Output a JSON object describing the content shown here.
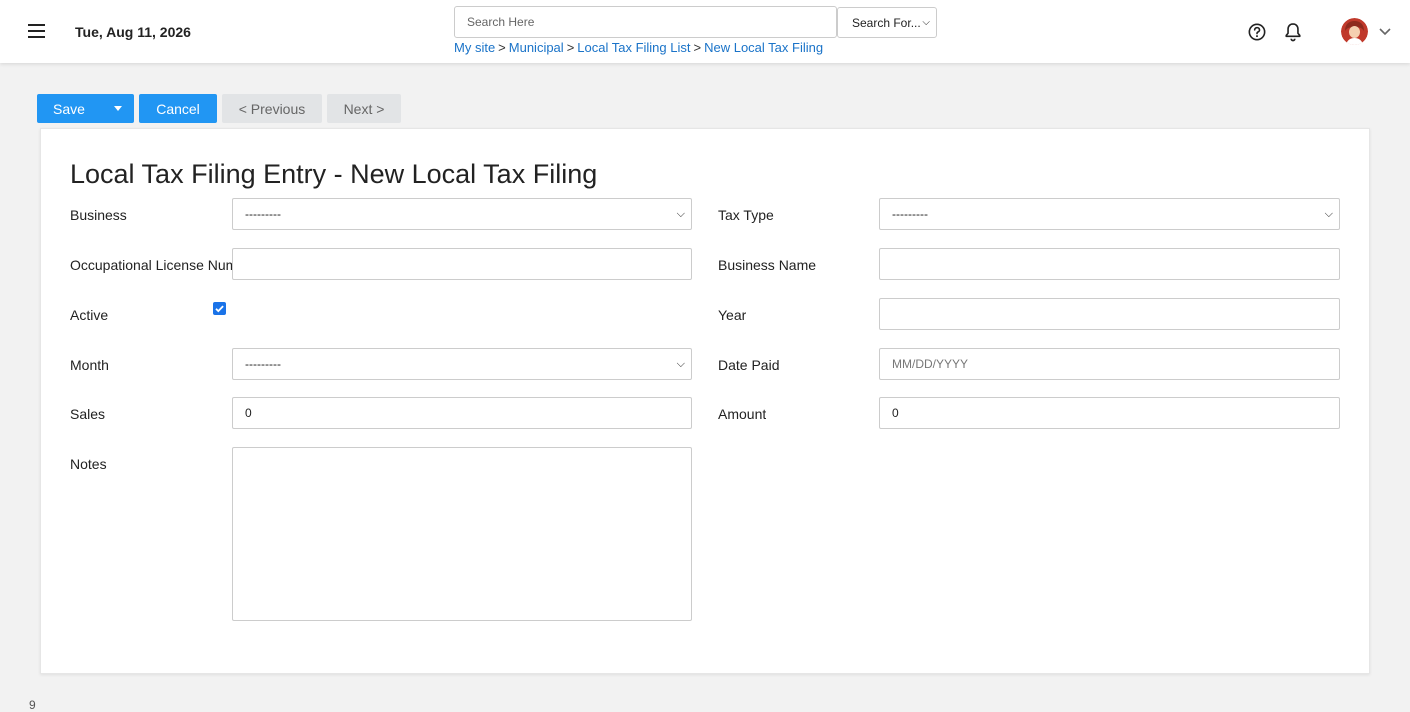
{
  "header": {
    "date": "Tue, Aug 11, 2026",
    "search_placeholder": "Search Here",
    "search_scope": "Search For...",
    "breadcrumb": [
      "My site",
      "Municipal",
      "Local Tax Filing List",
      "New Local Tax Filing"
    ],
    "breadcrumb_sep": ">"
  },
  "toolbar": {
    "save_label": "Save",
    "cancel_label": "Cancel",
    "previous_label": "< Previous",
    "next_label": "Next >"
  },
  "form": {
    "title": "Local Tax Filing Entry - New Local Tax Filing",
    "business": {
      "label": "Business",
      "value": "---------"
    },
    "tax_type": {
      "label": "Tax Type",
      "value": "---------"
    },
    "occupational_license": {
      "label": "Occupational License Num",
      "value": ""
    },
    "business_name": {
      "label": "Business Name",
      "value": ""
    },
    "active": {
      "label": "Active",
      "checked": true
    },
    "year": {
      "label": "Year",
      "value": ""
    },
    "month": {
      "label": "Month",
      "value": "---------"
    },
    "date_paid": {
      "label": "Date Paid",
      "placeholder": "MM/DD/YYYY"
    },
    "sales": {
      "label": "Sales",
      "value": "0"
    },
    "amount": {
      "label": "Amount",
      "value": "0"
    },
    "notes": {
      "label": "Notes",
      "value": ""
    }
  },
  "footer_stray": "9",
  "colors": {
    "primary": "#2196f3",
    "link": "#1a73c8",
    "disabled": "#e2e4e6",
    "background": "#f2f2f2"
  },
  "icons": [
    "menu-icon",
    "help-icon",
    "bell-icon",
    "avatar",
    "chevron-down-icon"
  ]
}
